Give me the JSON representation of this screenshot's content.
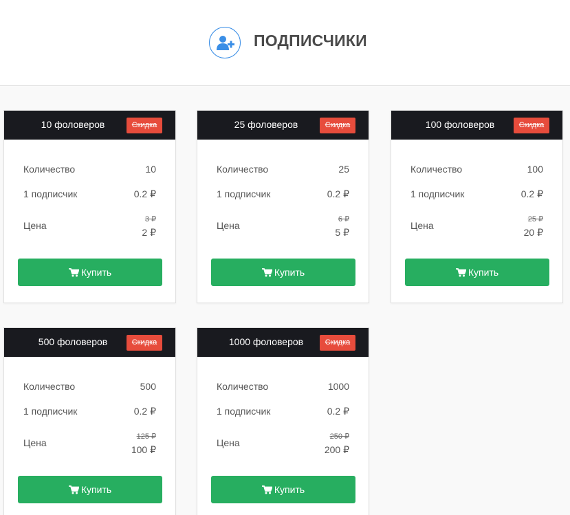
{
  "header": {
    "title": "ПОДПИСЧИКИ",
    "icon": "user-plus-icon",
    "accent_color": "#3a8ee6"
  },
  "labels": {
    "quantity": "Количество",
    "per_subscriber": "1 подписчик",
    "price": "Цена",
    "badge": "Скидка",
    "buy": "Купить"
  },
  "colors": {
    "card_header": "#191a1f",
    "badge": "#e74c3c",
    "buy_button": "#27ae60"
  },
  "cards": [
    {
      "title": "10 фоловеров",
      "quantity": "10",
      "unit_price": "0.2 ₽",
      "old_price": "3 ₽",
      "price": "2 ₽"
    },
    {
      "title": "25 фоловеров",
      "quantity": "25",
      "unit_price": "0.2 ₽",
      "old_price": "6 ₽",
      "price": "5 ₽"
    },
    {
      "title": "100 фоловеров",
      "quantity": "100",
      "unit_price": "0.2 ₽",
      "old_price": "25 ₽",
      "price": "20 ₽"
    },
    {
      "title": "500 фоловеров",
      "quantity": "500",
      "unit_price": "0.2 ₽",
      "old_price": "125 ₽",
      "price": "100 ₽"
    },
    {
      "title": "1000 фоловеров",
      "quantity": "1000",
      "unit_price": "0.2 ₽",
      "old_price": "250 ₽",
      "price": "200 ₽"
    }
  ]
}
